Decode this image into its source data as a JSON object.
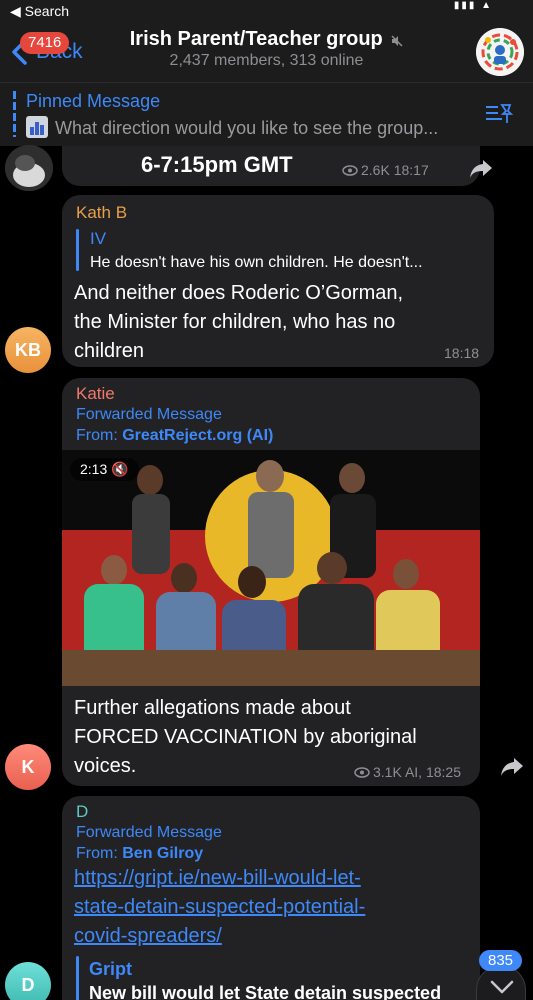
{
  "status_bar": {
    "back_app": "◀ Search"
  },
  "header": {
    "unread_badge": "7416",
    "back_label": "Back",
    "title": "Irish Parent/Teacher group",
    "subtitle": "2,437 members, 313 online"
  },
  "pinned": {
    "title": "Pinned Message",
    "text": "What direction would you like to see the group..."
  },
  "messages": [
    {
      "text": "6-7:15pm GMT",
      "views": "2.6K",
      "time": "18:17"
    },
    {
      "sender": "Kath B",
      "avatar_initials": "KB",
      "reply_to_name": "IV",
      "reply_to_text": "He doesn't have his own children. He doesn't...",
      "text_lines": [
        "And neither does Roderic O’Gorman,",
        "the Minister for children, who has no",
        "children"
      ],
      "time": "18:18"
    },
    {
      "sender": "Katie",
      "avatar_initials": "K",
      "forwarded_label": "Forwarded Message",
      "from_label": "From:",
      "from_source": "GreatReject.org (AI)",
      "video_duration": "2:13",
      "text_lines": [
        "Further allegations made about",
        "FORCED VACCINATION by aboriginal",
        "voices."
      ],
      "views": "3.1K",
      "time_meta": "AI, 18:25"
    },
    {
      "sender": "D",
      "avatar_initials": "D",
      "forwarded_label": "Forwarded Message",
      "from_label": "From:",
      "from_source": "Ben Gilroy",
      "link_lines": [
        "https://gript.ie/new-bill-would-let-",
        "state-detain-suspected-potential-",
        "covid-spreaders/"
      ],
      "preview_site": "Gript",
      "preview_title": "New bill would let State detain suspected"
    }
  ],
  "scroll_badge": "835",
  "colors": {
    "accent": "#3e88f7",
    "kath": "#e8a04a",
    "katie": "#f07a6a",
    "d": "#5fc9c4"
  }
}
